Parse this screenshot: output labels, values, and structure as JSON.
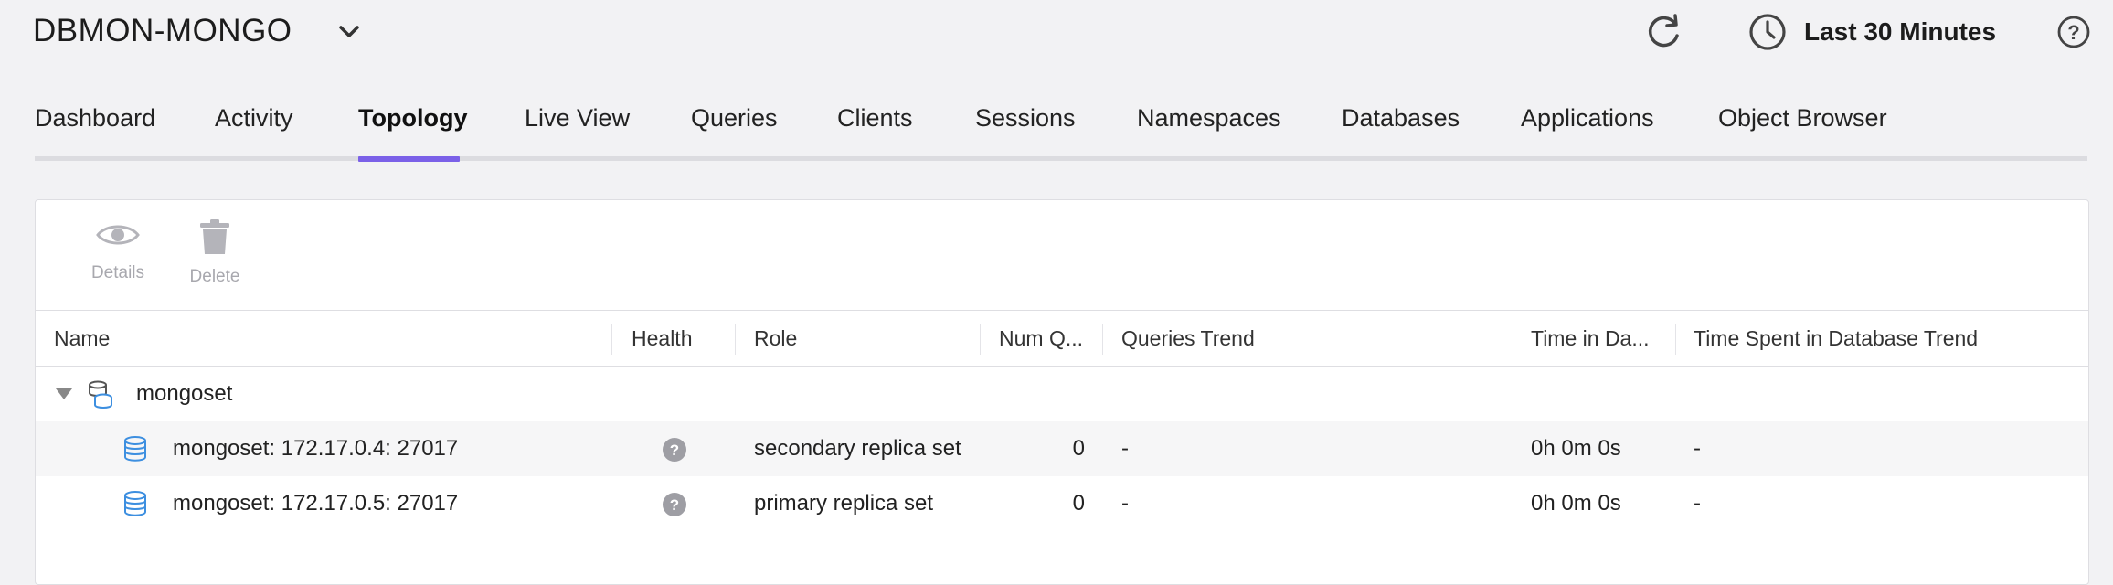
{
  "header": {
    "title": "DBMON-MONGO",
    "time_range": "Last 30 Minutes"
  },
  "tabs": [
    {
      "label": "Dashboard",
      "active": false
    },
    {
      "label": "Activity",
      "active": false
    },
    {
      "label": "Topology",
      "active": true
    },
    {
      "label": "Live View",
      "active": false
    },
    {
      "label": "Queries",
      "active": false
    },
    {
      "label": "Clients",
      "active": false
    },
    {
      "label": "Sessions",
      "active": false
    },
    {
      "label": "Namespaces",
      "active": false
    },
    {
      "label": "Databases",
      "active": false
    },
    {
      "label": "Applications",
      "active": false
    },
    {
      "label": "Object Browser",
      "active": false
    }
  ],
  "toolbar": {
    "details_label": "Details",
    "delete_label": "Delete"
  },
  "table": {
    "columns": [
      "Name",
      "Health",
      "Role",
      "Num Q...",
      "Queries Trend",
      "Time in Da...",
      "Time Spent in Database Trend"
    ],
    "group": {
      "name": "mongoset"
    },
    "rows": [
      {
        "name": "mongoset: 172.17.0.4: 27017",
        "role": "secondary replica set",
        "num_queries": "0",
        "queries_trend": "-",
        "time_in_db": "0h 0m 0s",
        "time_trend": "-"
      },
      {
        "name": "mongoset: 172.17.0.5: 27017",
        "role": "primary replica set",
        "num_queries": "0",
        "queries_trend": "-",
        "time_in_db": "0h 0m 0s",
        "time_trend": "-"
      }
    ]
  },
  "colors": {
    "accent": "#7b61e8",
    "db_icon": "#3d8fe0",
    "health_unknown": "#9e9ea4"
  }
}
